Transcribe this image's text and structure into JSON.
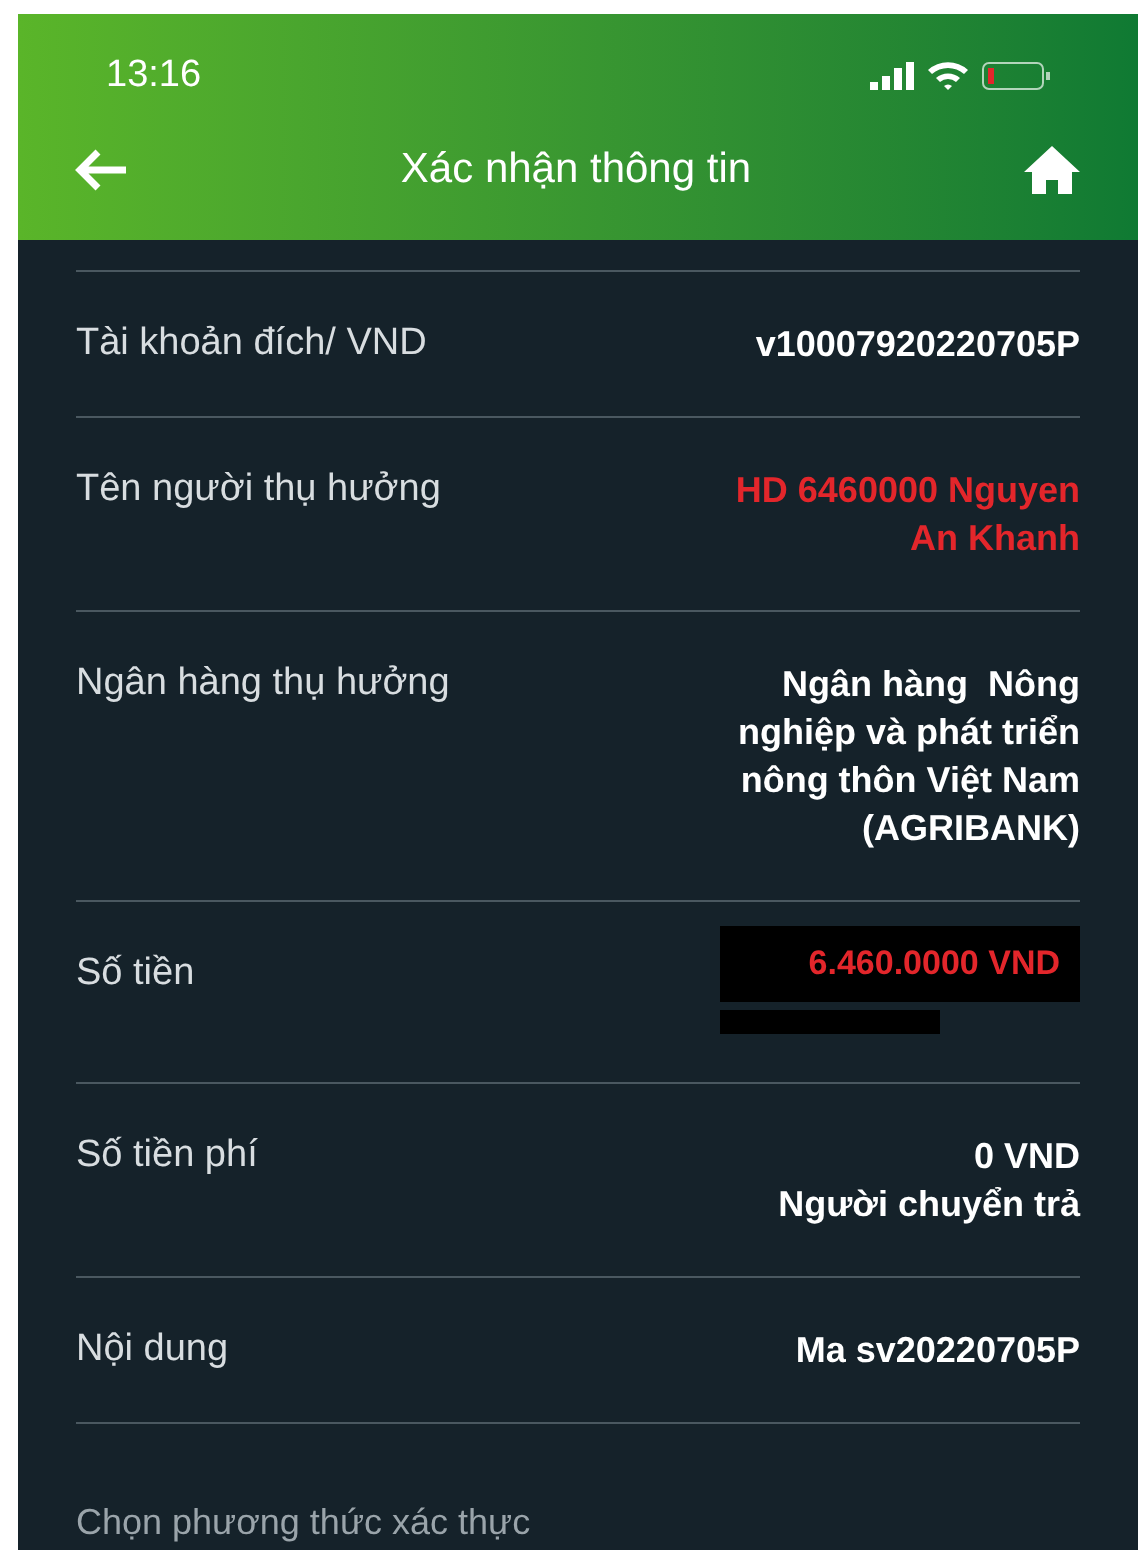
{
  "status_bar": {
    "time": "13:16"
  },
  "header": {
    "title": "Xác nhận thông tin"
  },
  "rows": [
    {
      "kind": "text",
      "label": "Tài khoản đích/ VND",
      "value": [
        "v10007920220705P"
      ],
      "color": "#ffffff"
    },
    {
      "kind": "text",
      "label": "Tên người thụ hưởng",
      "value": [
        "HD 6460000 Nguyen",
        "An Khanh"
      ],
      "color": "#e3262b"
    },
    {
      "kind": "text",
      "label": "Ngân hàng thụ hưởng",
      "value": [
        "Ngân hàng  Nông",
        "nghiệp và phát triển",
        "nông thôn Việt Nam",
        "(AGRIBANK)"
      ],
      "color": "#ffffff"
    },
    {
      "kind": "redacted",
      "label": "Số tiền",
      "value": [
        "6.460.0000 VND"
      ],
      "color": "#e3262b"
    },
    {
      "kind": "text",
      "label": "Số tiền phí",
      "value": [
        "0 VND",
        "Người chuyển trả"
      ],
      "color": "#ffffff"
    },
    {
      "kind": "text",
      "label": "Nội dung",
      "value": [
        "Ma sv20220705P"
      ],
      "color": "#ffffff"
    }
  ],
  "footer": {
    "prompt": "Chọn phương thức xác thực"
  }
}
